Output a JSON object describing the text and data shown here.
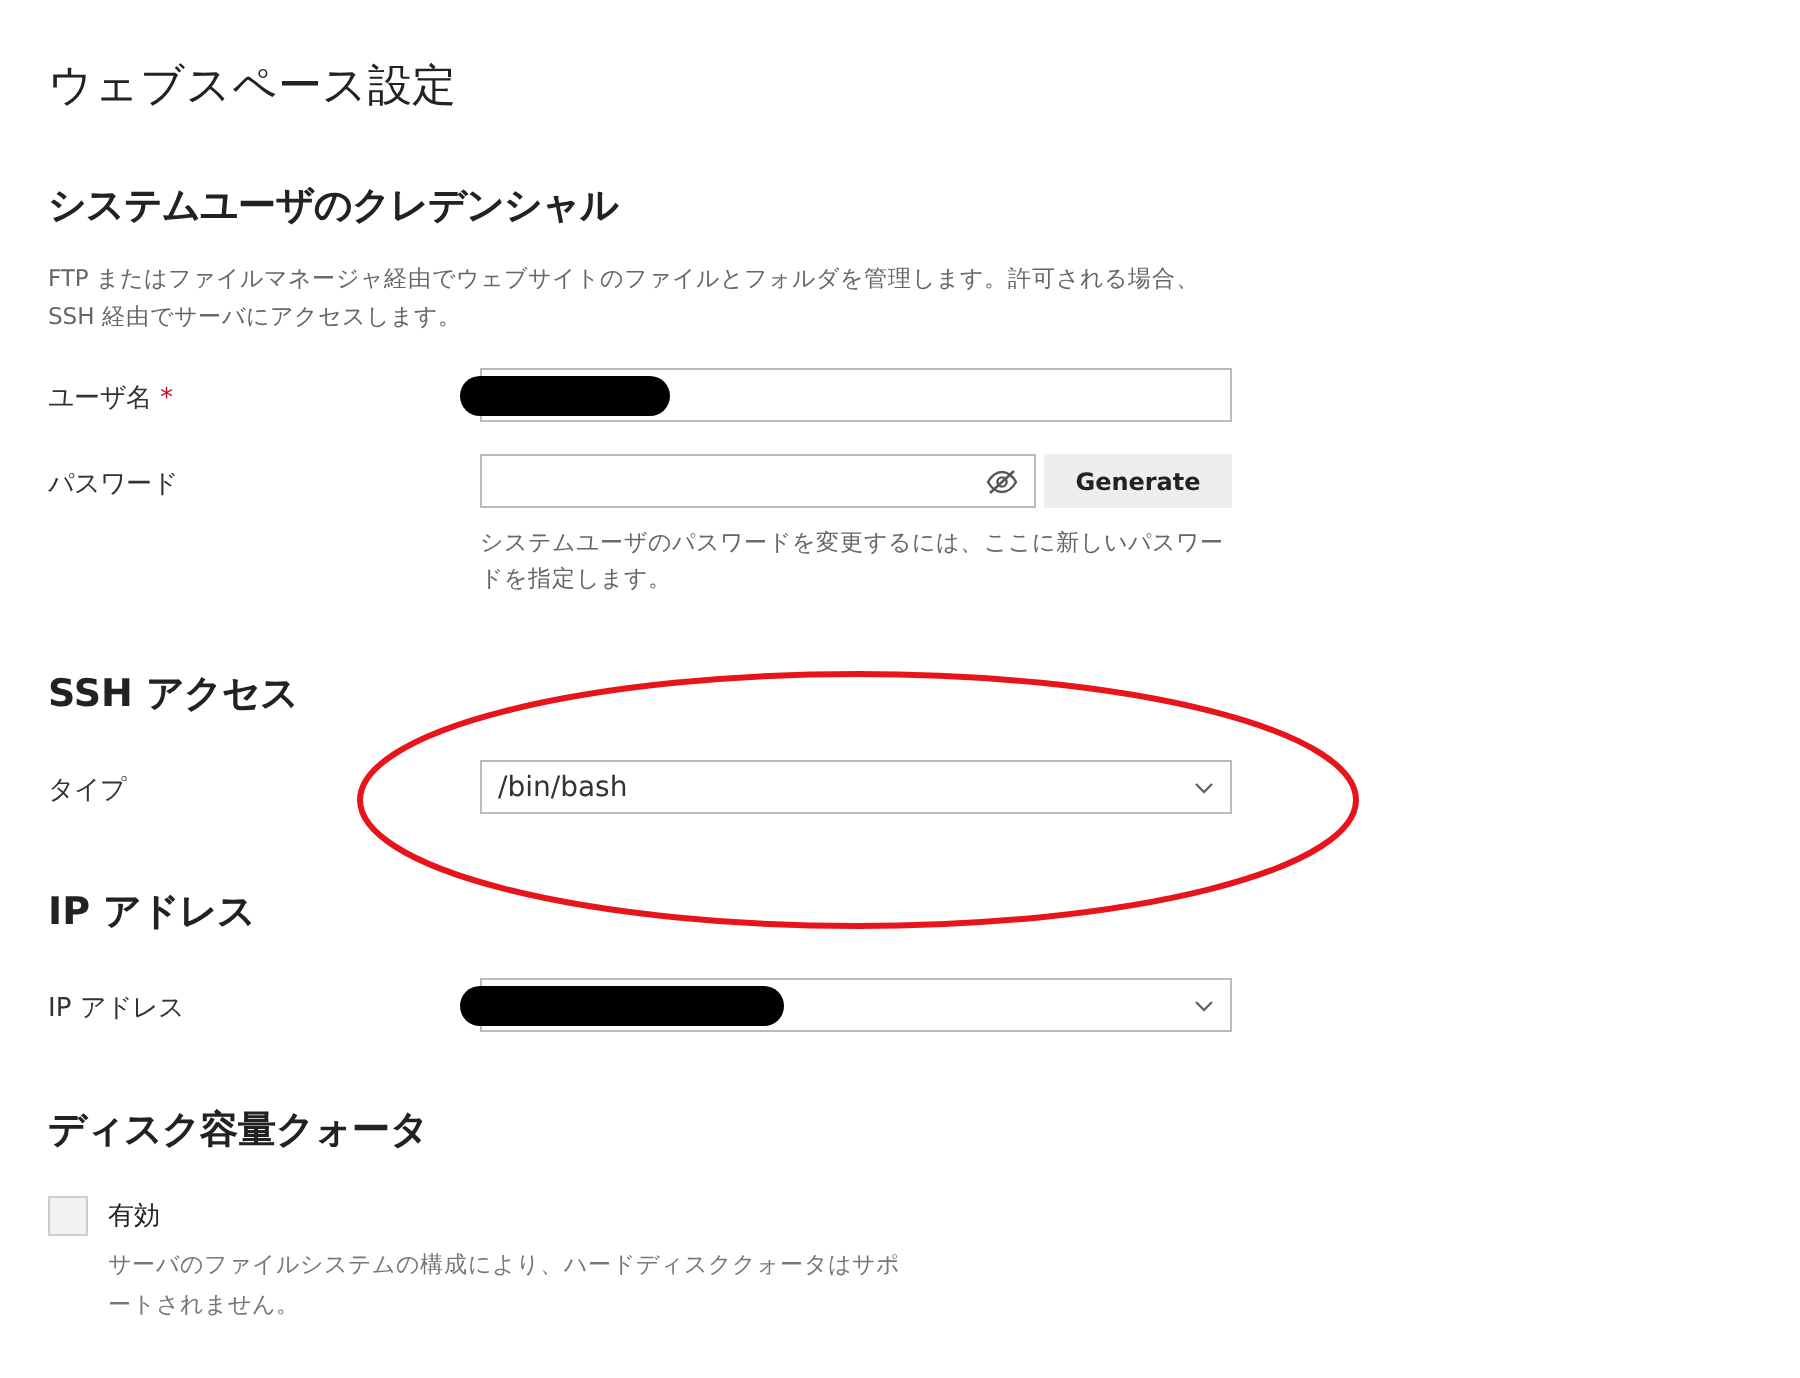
{
  "title": "ウェブスペース設定",
  "sections": [
    {
      "heading": "システムユーザのクレデンシャル",
      "description": "FTP またはファイルマネージャ経由でウェブサイトのファイルとフォルダを管理します。許可される場合、SSH 経由でサーバにアクセスします。",
      "fields": [
        {
          "kind": "text",
          "label": "ユーザ名",
          "required_mark": "*",
          "redacted": true
        },
        {
          "kind": "password",
          "label": "パスワード",
          "button": "Generate",
          "hint": "システムユーザのパスワードを変更するには、ここに新しいパスワードを指定します。"
        }
      ]
    },
    {
      "heading": "SSH アクセス",
      "fields": [
        {
          "kind": "select",
          "label": "タイプ",
          "value": "/bin/bash",
          "circled": true
        }
      ]
    },
    {
      "heading": "IP アドレス",
      "fields": [
        {
          "kind": "select",
          "label": "IP アドレス",
          "redacted": true
        }
      ]
    },
    {
      "heading": "ディスク容量クォータ",
      "fields": [
        {
          "kind": "checkbox",
          "label": "有効",
          "checked": false,
          "hint": "サーバのファイルシステムの構成により、ハードディスククォータはサポートされません。"
        }
      ]
    }
  ]
}
